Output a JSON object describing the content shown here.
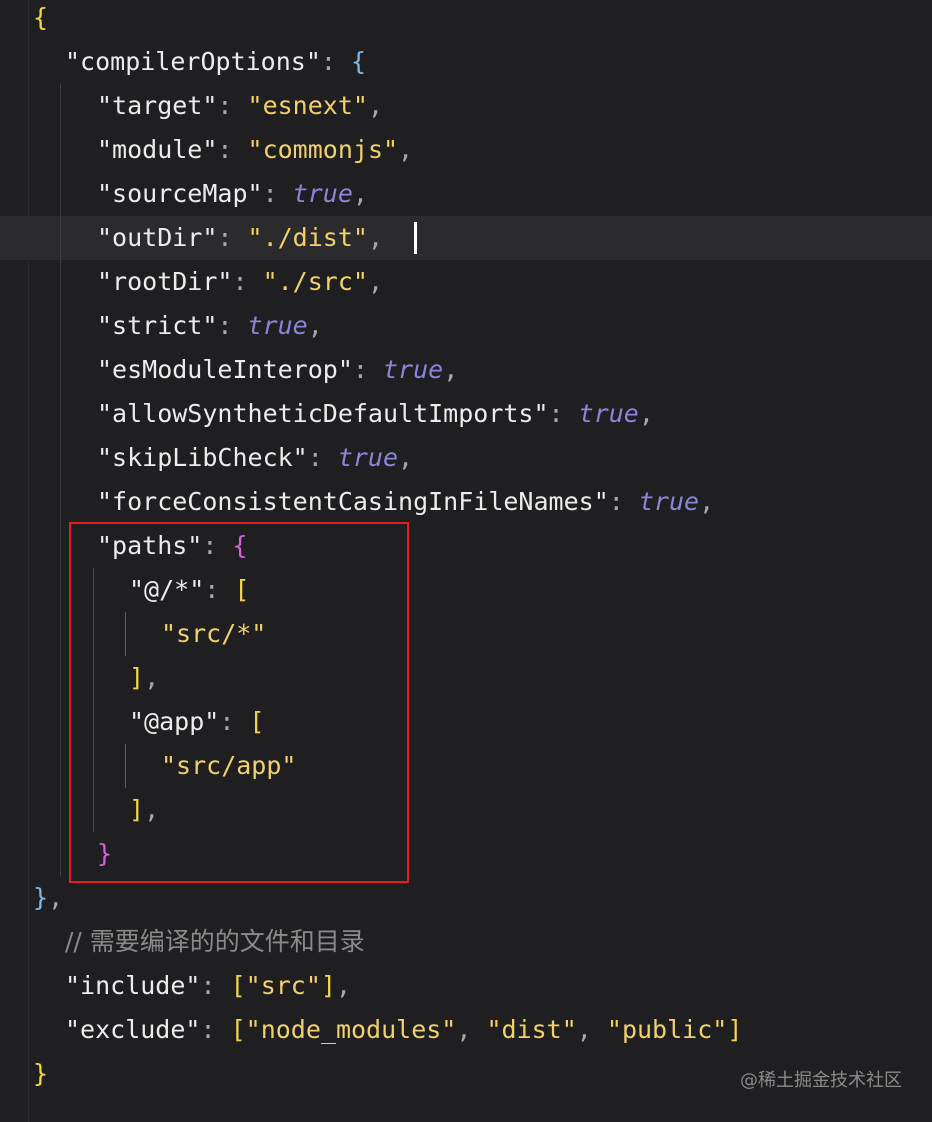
{
  "editor": {
    "lines": [
      {
        "id": "l1",
        "tokens": [
          {
            "t": "{",
            "c": "brace-y"
          }
        ]
      },
      {
        "id": "l2",
        "tokens": [
          {
            "t": "\"compilerOptions\"",
            "c": "k"
          },
          {
            "t": ": ",
            "c": "p"
          },
          {
            "t": "{",
            "c": "brace-b"
          }
        ]
      },
      {
        "id": "l3",
        "tokens": [
          {
            "t": "\"target\"",
            "c": "k"
          },
          {
            "t": ": ",
            "c": "p"
          },
          {
            "t": "\"esnext\"",
            "c": "s"
          },
          {
            "t": ",",
            "c": "p"
          }
        ]
      },
      {
        "id": "l4",
        "tokens": [
          {
            "t": "\"module\"",
            "c": "k"
          },
          {
            "t": ": ",
            "c": "p"
          },
          {
            "t": "\"commonjs\"",
            "c": "s"
          },
          {
            "t": ",",
            "c": "p"
          }
        ]
      },
      {
        "id": "l5",
        "tokens": [
          {
            "t": "\"sourceMap\"",
            "c": "k"
          },
          {
            "t": ": ",
            "c": "p"
          },
          {
            "t": "true",
            "c": "kw"
          },
          {
            "t": ",",
            "c": "p"
          }
        ]
      },
      {
        "id": "l6",
        "tokens": [
          {
            "t": "\"outDir\"",
            "c": "k"
          },
          {
            "t": ": ",
            "c": "p"
          },
          {
            "t": "\"./dist\"",
            "c": "s"
          },
          {
            "t": ",",
            "c": "p"
          }
        ]
      },
      {
        "id": "l7",
        "tokens": [
          {
            "t": "\"rootDir\"",
            "c": "k"
          },
          {
            "t": ": ",
            "c": "p"
          },
          {
            "t": "\"./src\"",
            "c": "s"
          },
          {
            "t": ",",
            "c": "p"
          }
        ]
      },
      {
        "id": "l8",
        "tokens": [
          {
            "t": "\"strict\"",
            "c": "k"
          },
          {
            "t": ": ",
            "c": "p"
          },
          {
            "t": "true",
            "c": "kw"
          },
          {
            "t": ",",
            "c": "p"
          }
        ]
      },
      {
        "id": "l9",
        "tokens": [
          {
            "t": "\"esModuleInterop\"",
            "c": "k"
          },
          {
            "t": ": ",
            "c": "p"
          },
          {
            "t": "true",
            "c": "kw"
          },
          {
            "t": ",",
            "c": "p"
          }
        ]
      },
      {
        "id": "l10",
        "tokens": [
          {
            "t": "\"allowSyntheticDefaultImports\"",
            "c": "k"
          },
          {
            "t": ": ",
            "c": "p"
          },
          {
            "t": "true",
            "c": "kw"
          },
          {
            "t": ",",
            "c": "p"
          }
        ]
      },
      {
        "id": "l11",
        "tokens": [
          {
            "t": "\"skipLibCheck\"",
            "c": "k"
          },
          {
            "t": ": ",
            "c": "p"
          },
          {
            "t": "true",
            "c": "kw"
          },
          {
            "t": ",",
            "c": "p"
          }
        ]
      },
      {
        "id": "l12",
        "tokens": [
          {
            "t": "\"forceConsistentCasingInFileNames\"",
            "c": "k"
          },
          {
            "t": ": ",
            "c": "p"
          },
          {
            "t": "true",
            "c": "kw"
          },
          {
            "t": ",",
            "c": "p"
          }
        ]
      },
      {
        "id": "l13",
        "tokens": [
          {
            "t": "\"paths\"",
            "c": "k"
          },
          {
            "t": ": ",
            "c": "p"
          },
          {
            "t": "{",
            "c": "brace-m"
          }
        ]
      },
      {
        "id": "l14",
        "tokens": [
          {
            "t": "\"@/*\"",
            "c": "k"
          },
          {
            "t": ": ",
            "c": "p"
          },
          {
            "t": "[",
            "c": "brace-y"
          }
        ]
      },
      {
        "id": "l15",
        "tokens": [
          {
            "t": "\"src/*\"",
            "c": "s"
          }
        ]
      },
      {
        "id": "l16",
        "tokens": [
          {
            "t": "]",
            "c": "brace-y"
          },
          {
            "t": ",",
            "c": "p"
          }
        ]
      },
      {
        "id": "l17",
        "tokens": [
          {
            "t": "\"@app\"",
            "c": "k"
          },
          {
            "t": ": ",
            "c": "p"
          },
          {
            "t": "[",
            "c": "brace-y"
          }
        ]
      },
      {
        "id": "l18",
        "tokens": [
          {
            "t": "\"src/app\"",
            "c": "s"
          }
        ]
      },
      {
        "id": "l19",
        "tokens": [
          {
            "t": "]",
            "c": "brace-y"
          },
          {
            "t": ",",
            "c": "p"
          }
        ]
      },
      {
        "id": "l20",
        "tokens": [
          {
            "t": "}",
            "c": "brace-m"
          }
        ]
      },
      {
        "id": "l21",
        "tokens": [
          {
            "t": "}",
            "c": "brace-b"
          },
          {
            "t": ",",
            "c": "p"
          }
        ]
      },
      {
        "id": "l22",
        "tokens": [
          {
            "t": "// 需要编译的的文件和目录",
            "c": "cm"
          }
        ]
      },
      {
        "id": "l23",
        "tokens": [
          {
            "t": "\"include\"",
            "c": "k"
          },
          {
            "t": ": ",
            "c": "p"
          },
          {
            "t": "[",
            "c": "brace-y"
          },
          {
            "t": "\"src\"",
            "c": "s"
          },
          {
            "t": "]",
            "c": "brace-y"
          },
          {
            "t": ",",
            "c": "p"
          }
        ]
      },
      {
        "id": "l24",
        "tokens": [
          {
            "t": "\"exclude\"",
            "c": "k"
          },
          {
            "t": ": ",
            "c": "p"
          },
          {
            "t": "[",
            "c": "brace-y"
          },
          {
            "t": "\"node_modules\"",
            "c": "s"
          },
          {
            "t": ", ",
            "c": "p"
          },
          {
            "t": "\"dist\"",
            "c": "s"
          },
          {
            "t": ", ",
            "c": "p"
          },
          {
            "t": "\"public\"",
            "c": "s"
          },
          {
            "t": "]",
            "c": "brace-y"
          }
        ]
      },
      {
        "id": "l25",
        "tokens": [
          {
            "t": "}",
            "c": "brace-y"
          }
        ]
      }
    ]
  },
  "watermark": "@稀土掘金技术社区",
  "colors": {
    "background": "#1f1f21",
    "highlight_border": "#e21b24",
    "string": "#f2d06b",
    "keyword_true": "#8c84d8",
    "brace_yellow": "#f5d44a",
    "brace_magenta": "#d562d2",
    "brace_blue": "#7db6e8"
  }
}
